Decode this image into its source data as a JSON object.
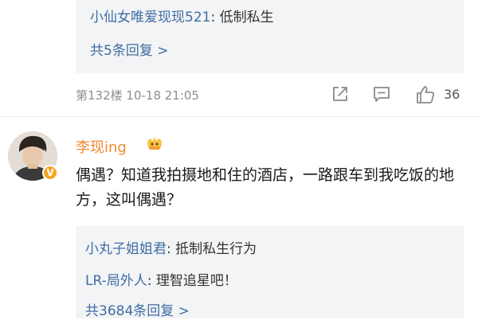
{
  "top_reply": {
    "user": "小仙女唯爱现现521",
    "separator": ": ",
    "text": "低制私生",
    "more_label": "共5条回复 >"
  },
  "meta": {
    "floor_time": "第132楼  10-18 21:05",
    "like_count": "36"
  },
  "comment": {
    "username": "李现ing",
    "text": "偶遇？知道我拍摄地和住的酒店，一路跟车到我吃饭的地方，这叫偶遇？"
  },
  "bottom_replies": {
    "items": [
      {
        "user": "小丸子姐姐君",
        "separator": ": ",
        "text": "抵制私生行为"
      },
      {
        "user": "LR-局外人",
        "separator": ": ",
        "text": "理智追星吧！"
      }
    ],
    "more_label": "共3684条回复 >"
  },
  "icons": {
    "share": "share-icon",
    "comment": "comment-icon",
    "like": "thumbs-up-icon",
    "verified": "verified-badge-icon",
    "fan_badge": "fan-badge-icon"
  },
  "colors": {
    "link_blue": "#3f6da3",
    "username_orange": "#f08a32",
    "reply_bg": "#f3f4f6",
    "meta_gray": "#8e8e8e",
    "verified_orange": "#f5a623"
  }
}
